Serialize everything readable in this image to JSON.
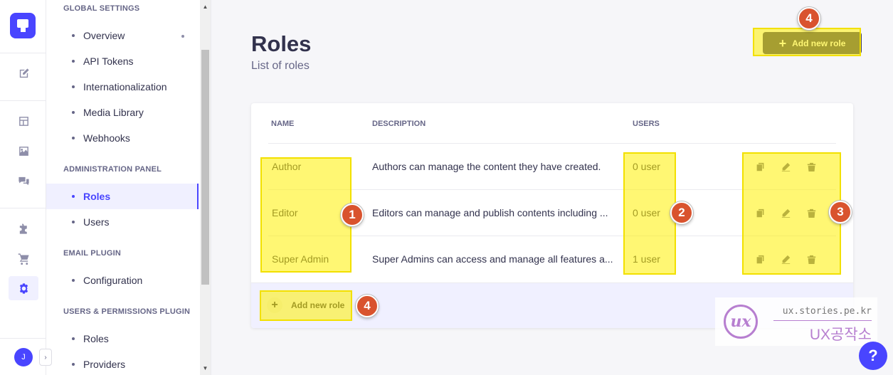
{
  "rail": {
    "avatar_initial": "J",
    "collapse_glyph": "›",
    "icons": [
      "logo-icon",
      "content-manager-icon",
      "content-type-builder-icon",
      "media-library-icon",
      "comments-icon",
      "plugins-icon",
      "marketplace-icon",
      "settings-icon"
    ]
  },
  "subnav": {
    "sections": [
      {
        "title": "GLOBAL SETTINGS"
      },
      {
        "title": "ADMINISTRATION PANEL"
      },
      {
        "title": "EMAIL PLUGIN"
      },
      {
        "title": "USERS & PERMISSIONS PLUGIN"
      }
    ],
    "items": {
      "overview": "Overview",
      "api_tokens": "API Tokens",
      "internationalization": "Internationalization",
      "media_library": "Media Library",
      "webhooks": "Webhooks",
      "roles": "Roles",
      "users": "Users",
      "configuration": "Configuration",
      "up_roles": "Roles",
      "providers": "Providers"
    }
  },
  "main": {
    "title": "Roles",
    "subtitle": "List of roles",
    "add_button_label": "Add new role",
    "table": {
      "headers": [
        "NAME",
        "DESCRIPTION",
        "USERS"
      ],
      "rows": [
        {
          "name": "Author",
          "description": "Authors can manage the content they have created.",
          "users": "0 user"
        },
        {
          "name": "Editor",
          "description": "Editors can manage and publish contents including ...",
          "users": "0 user"
        },
        {
          "name": "Super Admin",
          "description": "Super Admins can access and manage all features a...",
          "users": "1 user"
        }
      ],
      "footer_add_label": "Add new role"
    }
  },
  "annotations": {
    "badge_1": "1",
    "badge_2": "2",
    "badge_3": "3",
    "badge_4_top": "4",
    "badge_4_bottom": "4",
    "highlight_color": "#f2e000",
    "badge_color": "#d9532e"
  },
  "watermark": {
    "logo_text": "ux",
    "url": "ux.stories.pe.kr",
    "name": "UX공작소"
  },
  "help_label": "?"
}
